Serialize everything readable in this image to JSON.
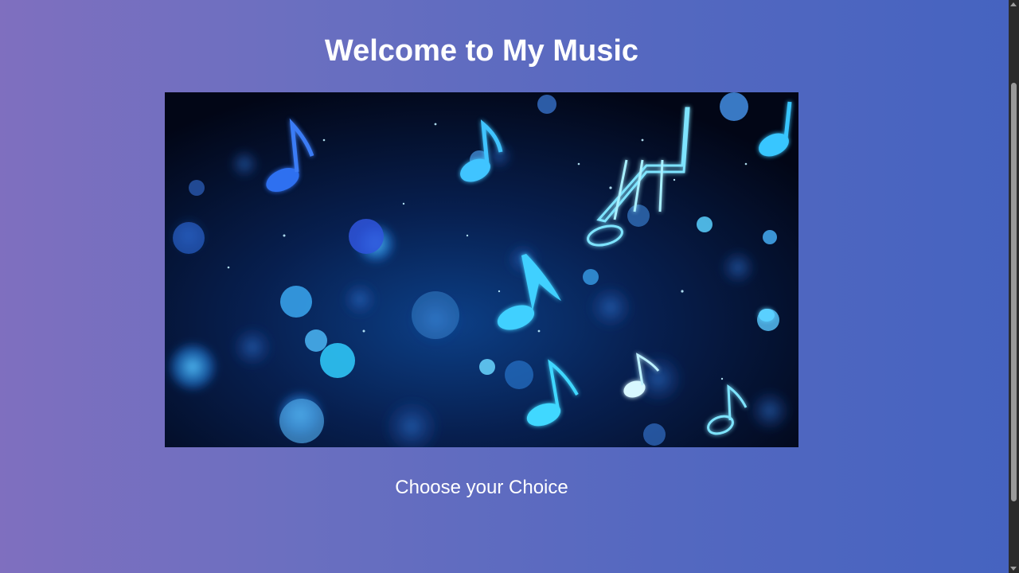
{
  "page": {
    "title": "Welcome to My Music",
    "choice_label": "Choose your Choice"
  },
  "hero": {
    "image_subject": "glowing blue music notes with bokeh",
    "icon": "music-notes-image"
  },
  "colors": {
    "background_start": "#7f6fbf",
    "background_end": "#4563c0",
    "text": "#ffffff",
    "note_glow": "#3fd0ff"
  },
  "scrollbar": {
    "visible": true
  }
}
